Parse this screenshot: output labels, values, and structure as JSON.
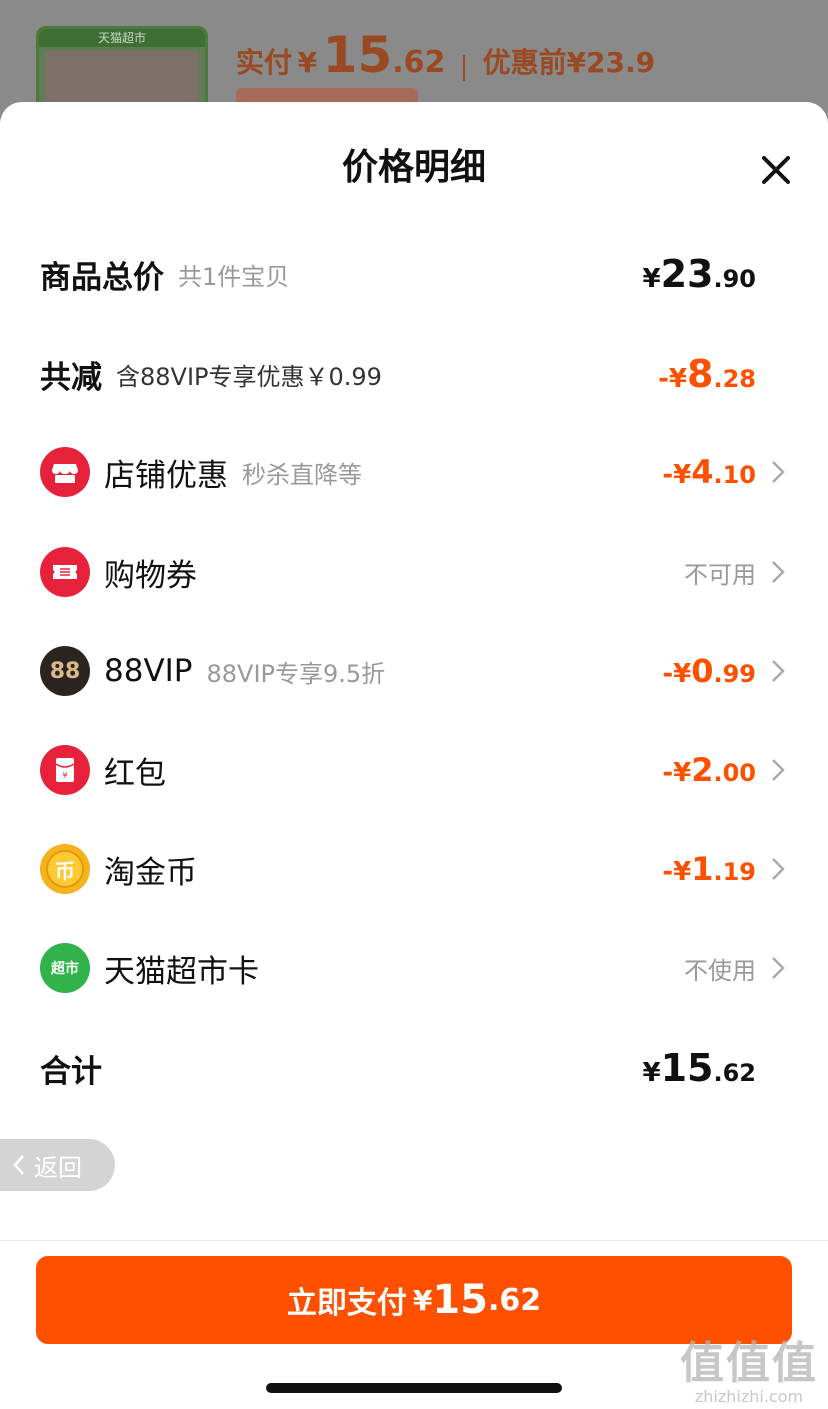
{
  "background_order": {
    "thumb_label": "天猫超市",
    "paid_label": "实付",
    "paid_currency": "¥",
    "paid_int": "15",
    "paid_dec": ".62",
    "before_label": "优惠前",
    "before_value": "¥23.9"
  },
  "sheet": {
    "title": "价格明细"
  },
  "rows": {
    "subtotal": {
      "label": "商品总价",
      "sub": "共1件宝贝",
      "cur": "¥",
      "int": "23",
      "dec": ".90"
    },
    "discount_total": {
      "label": "共减",
      "sub": "含88VIP专享优惠￥0.99",
      "cur": "-¥",
      "int": "8",
      "dec": ".28"
    },
    "shop_discount": {
      "label": "店铺优惠",
      "sub": "秒杀直降等",
      "cur": "-¥",
      "int": "4",
      "dec": ".10"
    },
    "coupon": {
      "label": "购物券",
      "value": "不可用"
    },
    "vip": {
      "label": "88VIP",
      "sub": "88VIP专享9.5折",
      "cur": "-¥",
      "int": "0",
      "dec": ".99",
      "icon_text": "88"
    },
    "red_packet": {
      "label": "红包",
      "cur": "-¥",
      "int": "2",
      "dec": ".00"
    },
    "gold_coin": {
      "label": "淘金币",
      "cur": "-¥",
      "int": "1",
      "dec": ".19",
      "icon_text": "币"
    },
    "tmall_card": {
      "label": "天猫超市卡",
      "value": "不使用",
      "icon_text": "超市"
    },
    "total": {
      "label": "合计",
      "cur": "¥",
      "int": "15",
      "dec": ".62"
    }
  },
  "back_button": {
    "label": "返回"
  },
  "pay_button": {
    "label": "立即支付",
    "cur": "¥",
    "int": "15",
    "dec": ".62"
  },
  "watermark": {
    "logo": "值值值",
    "url": "zhizhizhi.com"
  },
  "colors": {
    "accent": "#ff5000",
    "shop_icon": "#e8213a",
    "vip_icon": "#2b2421",
    "gold_icon": "#f5b21d",
    "tmall_card_icon": "#2fb34a"
  }
}
